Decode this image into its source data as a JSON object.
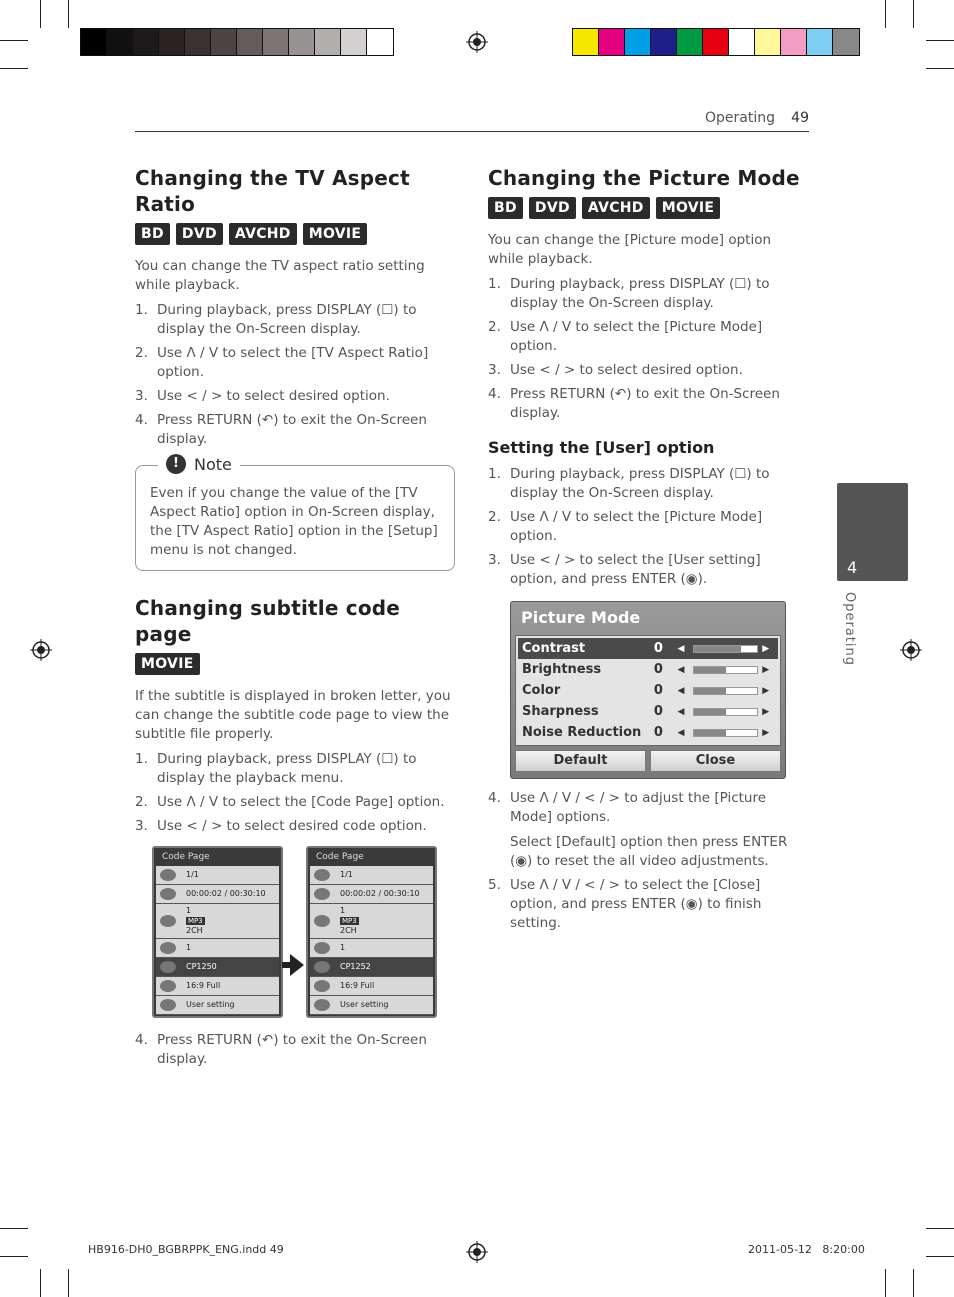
{
  "print_marks": {
    "grayscale": [
      "#000000",
      "#111111",
      "#1e1a1a",
      "#2b2424",
      "#3a3232",
      "#4d4444",
      "#645b5b",
      "#7d7676",
      "#999292",
      "#b3aeae",
      "#d4d0d0",
      "#ffffff"
    ],
    "colors": [
      "#f7e600",
      "#e4007f",
      "#00a0e9",
      "#1d2088",
      "#009944",
      "#e60012",
      "#ffffff",
      "#fff799",
      "#f19ec2",
      "#7ecef4",
      "#888888"
    ]
  },
  "header": {
    "section": "Operating",
    "page_number": "49"
  },
  "side_tab": {
    "number": "4",
    "label": "Operating"
  },
  "left": {
    "aspect": {
      "title": "Changing the TV Aspect Ratio",
      "badges": [
        "BD",
        "DVD",
        "AVCHD",
        "MOVIE"
      ],
      "intro": "You can change the TV aspect ratio setting while playback.",
      "steps": [
        {
          "n": "1.",
          "text": "During playback, press DISPLAY (☐) to display the On-Screen display."
        },
        {
          "n": "2.",
          "text": "Use Λ / V to select the [TV Aspect Ratio] option."
        },
        {
          "n": "3.",
          "text": "Use < / > to select desired option."
        },
        {
          "n": "4.",
          "text": "Press RETURN (↶) to exit the On-Screen display."
        }
      ]
    },
    "note": {
      "title": "Note",
      "icon": "!",
      "text": "Even if you change the value of the [TV Aspect Ratio] option in On-Screen display, the [TV Aspect Ratio] option in the [Setup] menu is not changed."
    },
    "subtitle": {
      "title": "Changing subtitle code page",
      "badges": [
        "MOVIE"
      ],
      "intro": "If the subtitle is displayed in broken letter, you can change the subtitle code page to view the subtitle file properly.",
      "steps": [
        {
          "n": "1.",
          "text": "During playback, press DISPLAY (☐) to display the playback menu."
        },
        {
          "n": "2.",
          "text": "Use Λ / V to select the [Code Page] option."
        },
        {
          "n": "3.",
          "text": "Use < / > to select desired code option."
        }
      ],
      "step4": {
        "n": "4.",
        "text": "Press RETURN (↶) to exit the On-Screen display."
      }
    },
    "screens": [
      {
        "title": "Code Page",
        "rows": [
          {
            "icon": "disc-icon",
            "text": "1/1"
          },
          {
            "icon": "clock-icon",
            "text": "00:00:02 / 00:30:10"
          },
          {
            "icon": "audio-icon",
            "line1": "1",
            "badge": "MP3",
            "line3": "2CH"
          },
          {
            "icon": "subtitle-icon",
            "text": "1"
          },
          {
            "icon": "codepage-icon",
            "text": "CP1250",
            "selected": true
          },
          {
            "icon": "aspect-icon",
            "text": "16:9 Full"
          },
          {
            "icon": "picture-icon",
            "text": "User setting"
          }
        ]
      },
      {
        "title": "Code Page",
        "rows": [
          {
            "icon": "disc-icon",
            "text": "1/1"
          },
          {
            "icon": "clock-icon",
            "text": "00:00:02 / 00:30:10"
          },
          {
            "icon": "audio-icon",
            "line1": "1",
            "badge": "MP3",
            "line3": "2CH"
          },
          {
            "icon": "subtitle-icon",
            "text": "1"
          },
          {
            "icon": "codepage-icon",
            "text": "CP1252",
            "selected": true
          },
          {
            "icon": "aspect-icon",
            "text": "16:9 Full"
          },
          {
            "icon": "picture-icon",
            "text": "User setting"
          }
        ]
      }
    ]
  },
  "right": {
    "picture": {
      "title": "Changing the Picture Mode",
      "badges": [
        "BD",
        "DVD",
        "AVCHD",
        "MOVIE"
      ],
      "intro": "You can change the [Picture mode] option while playback.",
      "steps": [
        {
          "n": "1.",
          "text": "During playback, press DISPLAY (☐) to display the On-Screen display."
        },
        {
          "n": "2.",
          "text": "Use Λ / V to select the [Picture Mode] option."
        },
        {
          "n": "3.",
          "text": "Use < / > to select desired option."
        },
        {
          "n": "4.",
          "text": "Press RETURN (↶) to exit the On-Screen display."
        }
      ]
    },
    "user": {
      "title": "Setting the [User] option",
      "steps": [
        {
          "n": "1.",
          "text": "During playback, press DISPLAY (☐) to display the On-Screen display."
        },
        {
          "n": "2.",
          "text": "Use Λ / V to select the [Picture Mode] option."
        },
        {
          "n": "3.",
          "text": "Use < / > to select the [User setting] option, and press ENTER (◉)."
        }
      ],
      "steps_after": [
        {
          "n": "4.",
          "text": "Use Λ / V / < / > to adjust the [Picture Mode] options.",
          "sub": "Select [Default] option then press ENTER (◉) to reset the all video adjustments."
        },
        {
          "n": "5.",
          "text": "Use Λ / V / < / > to select the [Close] option, and press ENTER (◉) to finish setting."
        }
      ]
    },
    "menu": {
      "title": "Picture Mode",
      "rows": [
        {
          "label": "Contrast",
          "value": "0",
          "level": 0.75,
          "selected": true
        },
        {
          "label": "Brightness",
          "value": "0",
          "level": 0.5,
          "selected": false
        },
        {
          "label": "Color",
          "value": "0",
          "level": 0.5,
          "selected": false
        },
        {
          "label": "Sharpness",
          "value": "0",
          "level": 0.5,
          "selected": false
        },
        {
          "label": "Noise Reduction",
          "value": "0",
          "level": 0.5,
          "selected": false
        }
      ],
      "buttons": [
        "Default",
        "Close"
      ]
    }
  },
  "footer": {
    "file": "HB916-DH0_BGBRPPK_ENG.indd   49",
    "timestamp": "2011-05-12     8:20:00"
  }
}
